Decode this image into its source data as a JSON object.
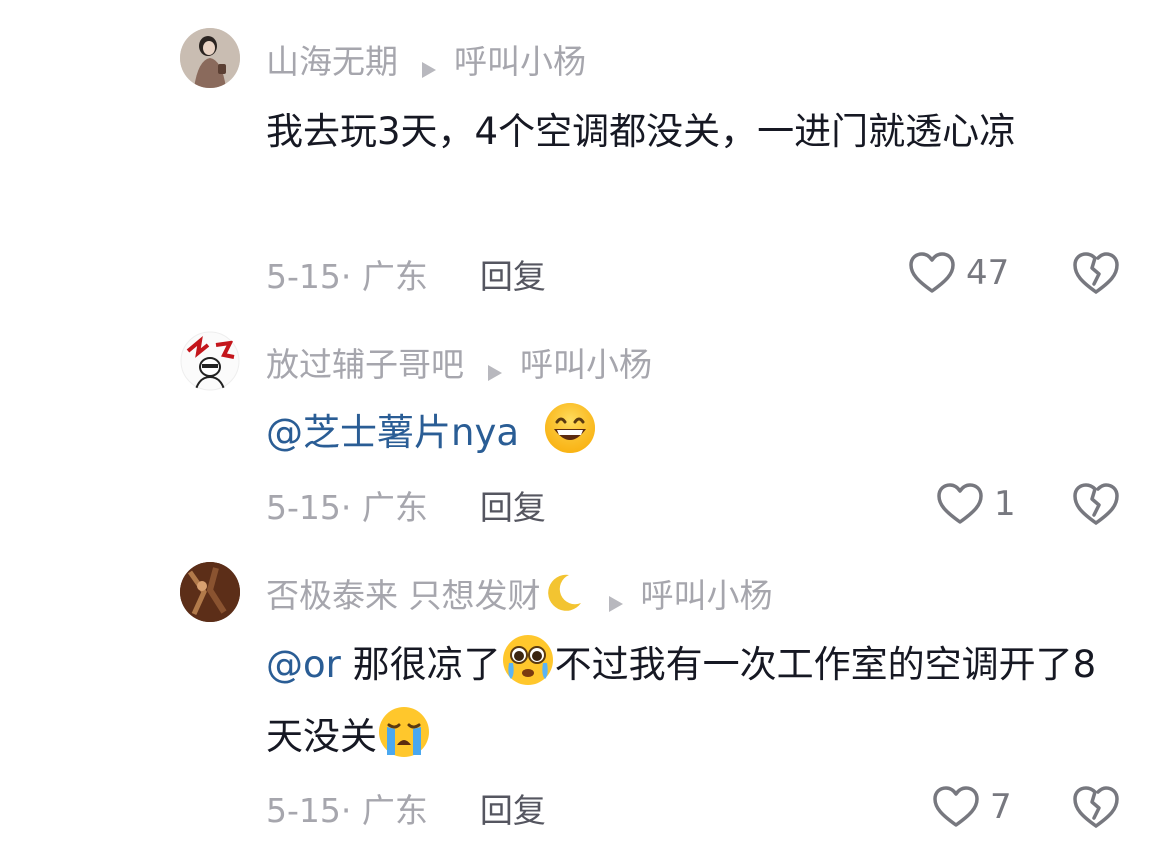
{
  "comments": [
    {
      "author": "山海无期",
      "reply_to": "呼叫小杨",
      "text": "我去玩3天，4个空调都没关，一进门就透心凉",
      "date_location": "5-15· 广东",
      "reply_label": "回复",
      "likes": "47"
    },
    {
      "author": "放过辅子哥吧",
      "reply_to": "呼叫小杨",
      "mention": "@芝士薯片nya",
      "date_location": "5-15· 广东",
      "reply_label": "回复",
      "likes": "1"
    },
    {
      "author": "否极泰来 只想发财",
      "reply_to": "呼叫小杨",
      "mention": "@or",
      "text_part1": " 那很凉了",
      "text_part2": "不过我有一次工作室的空调开了8天没关",
      "date_location": "5-15· 广东",
      "reply_label": "回复",
      "likes": "7"
    }
  ],
  "icons": {
    "arrow": "reply-arrow-icon",
    "like": "heart-icon",
    "dislike": "broken-heart-icon",
    "emoji_grin": "grinning-emoji-icon",
    "emoji_pleading": "pleading-tears-emoji-icon",
    "emoji_cry": "crying-emoji-icon",
    "moon": "crescent-moon-icon"
  },
  "colors": {
    "mention": "#2a5d95",
    "meta": "#a6a6ad",
    "text": "#161823"
  }
}
